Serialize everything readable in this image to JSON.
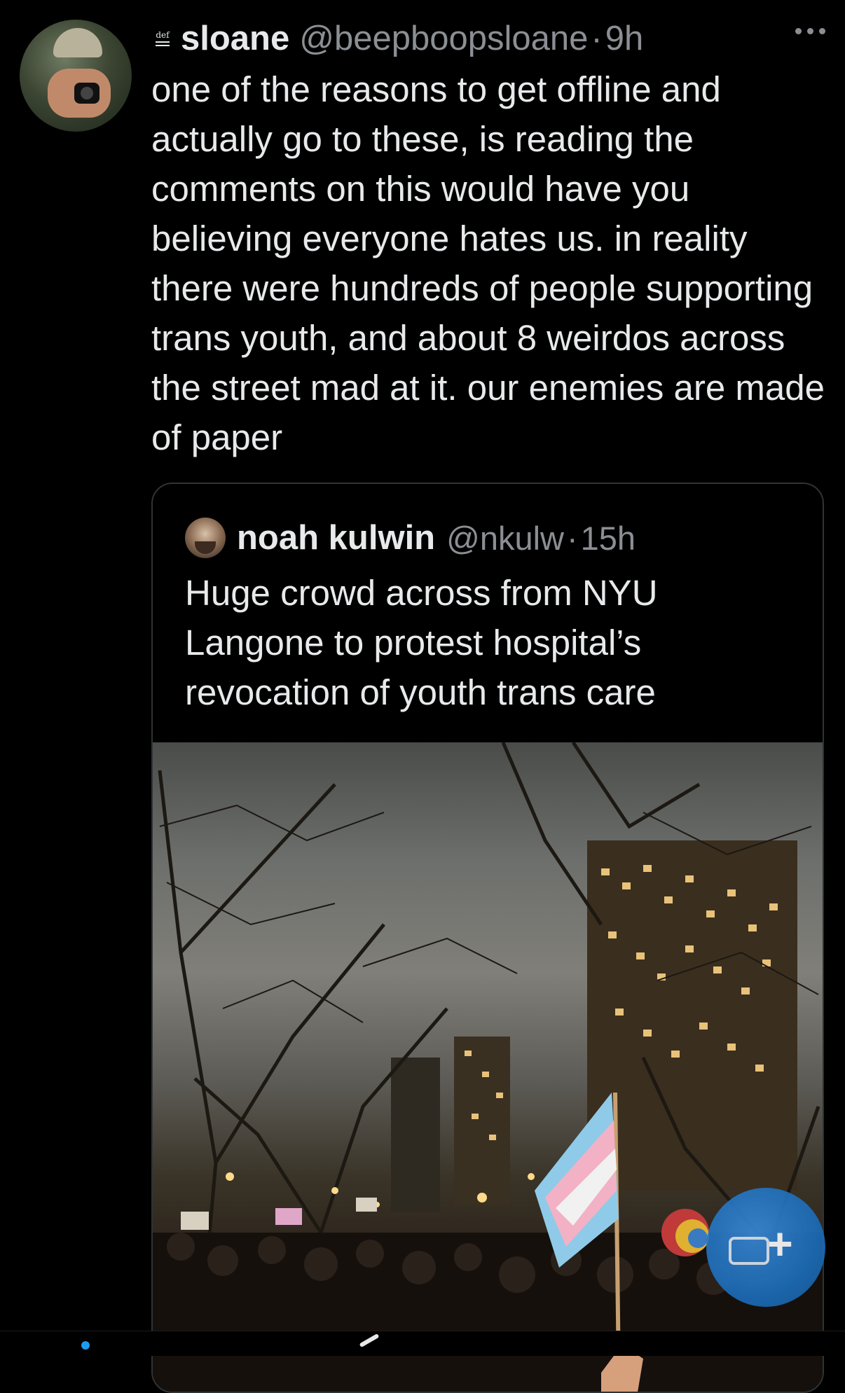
{
  "tweet": {
    "author_name": "sloane",
    "author_handle": "@beepboopsloane",
    "separator": "·",
    "time": "9h",
    "badge_icon": "dictionary-def-icon",
    "badge_text": "def",
    "text": "one of the reasons to get offline and actually go to these, is reading the comments on this would have you believing everyone hates us. in reality there were hundreds of people supporting trans youth, and about 8 weirdos across the street mad at it. our enemies are made of paper",
    "more_icon": "more-horizontal-icon"
  },
  "quoted_tweet": {
    "author_name": "noah kulwin",
    "author_handle": "@nkulw",
    "separator": "·",
    "time": "15h",
    "text": "Huge crowd across from NYU Langone to protest hospital’s revocation of youth trans care",
    "media": "protest-crowd-night-photo"
  },
  "compose_button": {
    "icon": "add-photo-icon",
    "symbol": "+"
  },
  "colors": {
    "background": "#000000",
    "text": "#e7e9ea",
    "muted": "#8b8f94",
    "border": "#2f3336",
    "accent": "#1d9bf0"
  }
}
